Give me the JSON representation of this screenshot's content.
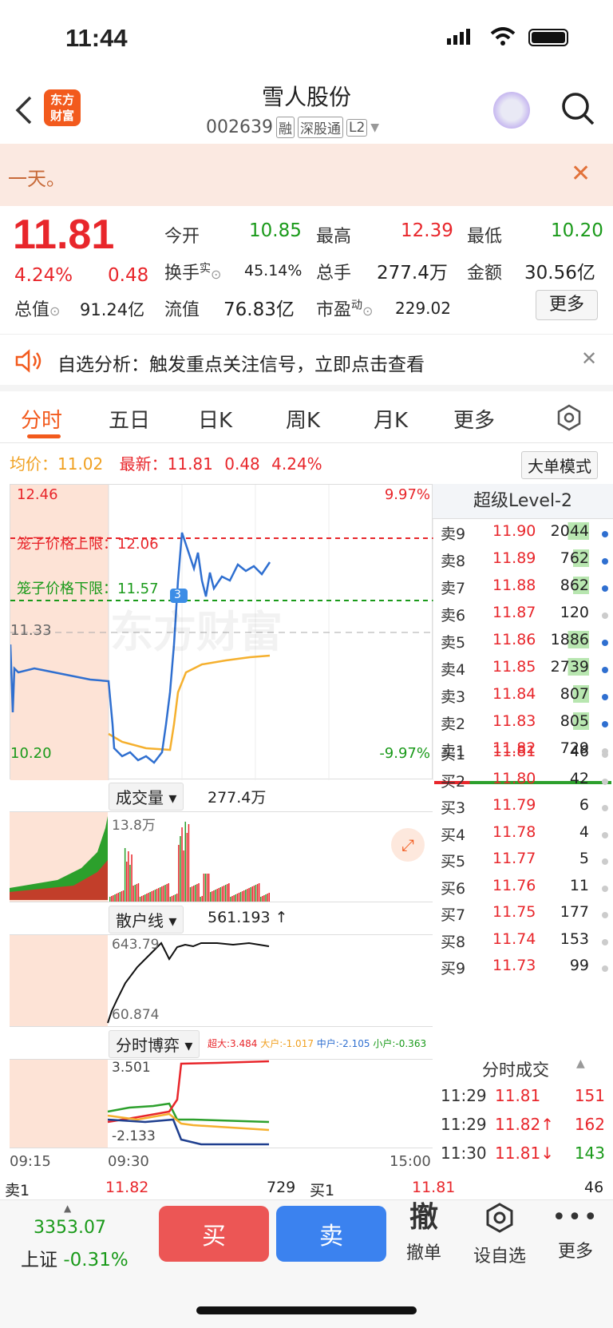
{
  "status": {
    "time": "11:44"
  },
  "header": {
    "name": "雪人股份",
    "code": "002639",
    "tags": [
      "融",
      "深股通",
      "L2"
    ]
  },
  "logo": {
    "line1": "东方",
    "line2": "财富"
  },
  "banner": {
    "text": "一天。"
  },
  "quote": {
    "price": "11.81",
    "pct": "4.24%",
    "chg": "0.48",
    "open_l": "今开",
    "open": "10.85",
    "high_l": "最高",
    "high": "12.39",
    "low_l": "最低",
    "low": "10.20",
    "turn_l": "换手",
    "turn_sup": "实",
    "turn": "45.14%",
    "vol_l": "总手",
    "vol": "277.4万",
    "amt_l": "金额",
    "amt": "30.56亿",
    "mcap_l": "总值",
    "mcap": "91.24亿",
    "float_l": "流值",
    "float": "76.83亿",
    "pe_l": "市盈",
    "pe_sup": "动",
    "pe": "229.02",
    "more": "更多"
  },
  "notice": {
    "text": "自选分析：触发重点关注信号，立即点击查看"
  },
  "tabs": [
    "分时",
    "五日",
    "日K",
    "周K",
    "月K",
    "更多"
  ],
  "info": {
    "avg_l": "均价：",
    "avg": "11.02",
    "last_l": "最新：",
    "last": "11.81",
    "chg": "0.48",
    "pct": "4.24%",
    "mode": "大单模式"
  },
  "chart": {
    "ymax": "12.46",
    "ymin": "10.20",
    "pmax": "9.97%",
    "pmin": "-9.97%",
    "mid": "11.33",
    "upper": "笼子价格上限：12.06",
    "lower": "笼子价格下限：11.57",
    "watermark": "东方财富",
    "marker": "3"
  },
  "vol_panel": {
    "sel": "成交量",
    "total": "277.4万",
    "max": "13.8万"
  },
  "retail_panel": {
    "sel": "散户线",
    "val": "561.193 ↑",
    "max": "643.79",
    "min": "60.874"
  },
  "game_panel": {
    "sel": "分时博弈",
    "super": "超大:3.484",
    "big": "大户:-1.017",
    "mid": "中户:-2.105",
    "small": "小户:-0.363",
    "max": "3.501",
    "min": "-2.133"
  },
  "times": [
    "09:15",
    "09:30",
    "15:00"
  ],
  "level2": {
    "title": "超级Level-2",
    "asks": [
      [
        "卖9",
        "11.90",
        "2044",
        "blue"
      ],
      [
        "卖8",
        "11.89",
        "762",
        "blue"
      ],
      [
        "卖7",
        "11.88",
        "862",
        "blue"
      ],
      [
        "卖6",
        "11.87",
        "120",
        "gray"
      ],
      [
        "卖5",
        "11.86",
        "1886",
        "blue"
      ],
      [
        "卖4",
        "11.85",
        "2739",
        "blue"
      ],
      [
        "卖3",
        "11.84",
        "807",
        "blue"
      ],
      [
        "卖2",
        "11.83",
        "805",
        "blue"
      ],
      [
        "卖1",
        "11.82",
        "729",
        "gray"
      ]
    ],
    "bids": [
      [
        "买1",
        "11.81",
        "46",
        "gray"
      ],
      [
        "买2",
        "11.80",
        "42",
        "gray"
      ],
      [
        "买3",
        "11.79",
        "6",
        "gray"
      ],
      [
        "买4",
        "11.78",
        "4",
        "gray"
      ],
      [
        "买5",
        "11.77",
        "5",
        "gray"
      ],
      [
        "买6",
        "11.76",
        "11",
        "gray"
      ],
      [
        "买7",
        "11.75",
        "177",
        "gray"
      ],
      [
        "买8",
        "11.74",
        "153",
        "gray"
      ],
      [
        "买9",
        "11.73",
        "99",
        "gray"
      ]
    ]
  },
  "ticks": {
    "title": "分时成交",
    "rows": [
      [
        "11:29",
        "11.81",
        "151",
        "red"
      ],
      [
        "11:29",
        "11.82↑",
        "162",
        "red"
      ],
      [
        "11:30",
        "11.81↓",
        "143",
        "green"
      ]
    ]
  },
  "footer_quote": {
    "ask_l": "卖1",
    "ask": "11.82",
    "ask_v": "729",
    "bid_l": "买1",
    "bid": "11.81",
    "bid_v": "46"
  },
  "bottom": {
    "index": "3353.07",
    "index_name": "上证",
    "index_pct": "-0.31%",
    "buy": "买",
    "sell": "卖",
    "cancel": "撤单",
    "cancel_icon": "撤",
    "watch": "设自选",
    "more": "更多"
  }
}
